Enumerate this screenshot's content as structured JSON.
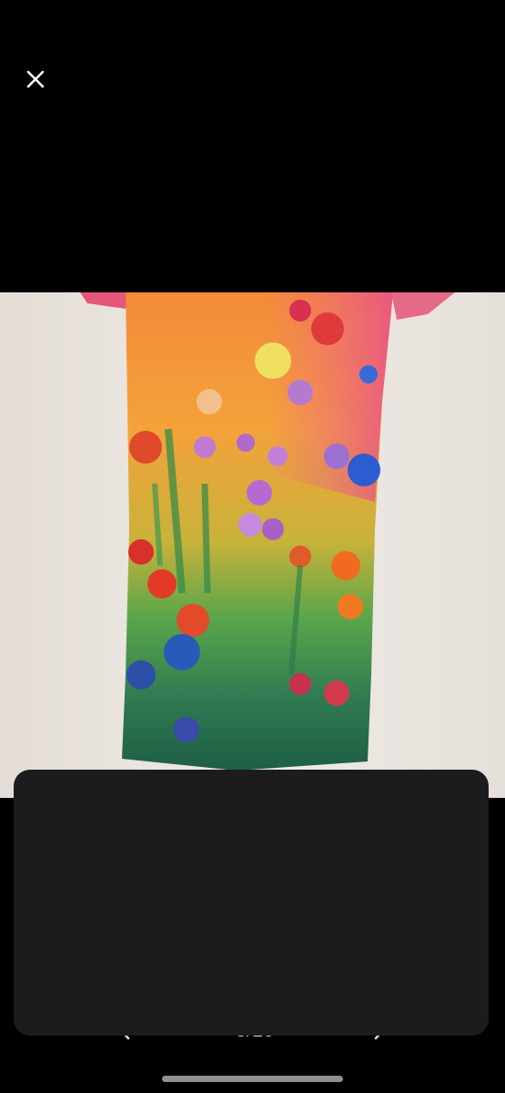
{
  "viewer": {
    "close_icon": "close-icon",
    "photo_alt": "",
    "pager": {
      "prev_icon": "chevron-left-icon",
      "next_icon": "chevron-right-icon",
      "count": "3/10"
    }
  },
  "colors": {
    "background": "#000000",
    "sheet": "#1c1c1e",
    "home_indicator": "#8e8e93"
  }
}
